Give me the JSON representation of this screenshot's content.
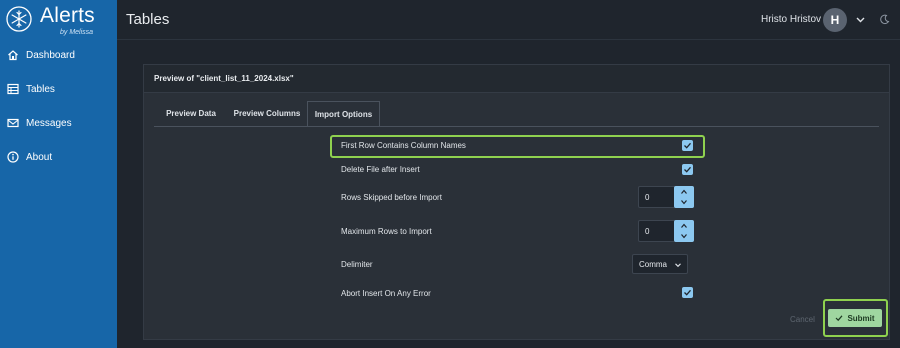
{
  "brand": {
    "title": "Alerts",
    "subtitle": "by Melissa",
    "logo_icon": "snowflake-icon"
  },
  "sidebar": {
    "items": [
      {
        "label": "Dashboard",
        "icon": "home-icon"
      },
      {
        "label": "Tables",
        "icon": "table-icon"
      },
      {
        "label": "Messages",
        "icon": "envelope-icon"
      },
      {
        "label": "About",
        "icon": "info-icon"
      }
    ]
  },
  "header": {
    "title": "Tables",
    "user_name": "Hristo Hristov",
    "avatar_initial": "H",
    "theme_icon": "moon-icon"
  },
  "card": {
    "title": "Preview of \"client_list_11_2024.xlsx\"",
    "tabs": [
      {
        "label": "Preview Data",
        "active": false
      },
      {
        "label": "Preview Columns",
        "active": false
      },
      {
        "label": "Import Options",
        "active": true
      }
    ]
  },
  "options": {
    "first_row_label": "First Row Contains Column Names",
    "first_row_checked": true,
    "delete_file_label": "Delete File after Insert",
    "delete_file_checked": true,
    "rows_skipped_label": "Rows Skipped before Import",
    "rows_skipped_value": "0",
    "max_rows_label": "Maximum Rows to Import",
    "max_rows_value": "0",
    "delimiter_label": "Delimiter",
    "delimiter_value": "Comma",
    "abort_label": "Abort Insert On Any Error",
    "abort_checked": true
  },
  "actions": {
    "cancel_label": "Cancel",
    "submit_label": "Submit"
  },
  "colors": {
    "sidebar": "#1766a8",
    "background": "#1f252d",
    "card": "#2a3038",
    "checkbox": "#8cc8f0",
    "highlight": "#8fd14f",
    "submit": "#9fd6a0"
  }
}
